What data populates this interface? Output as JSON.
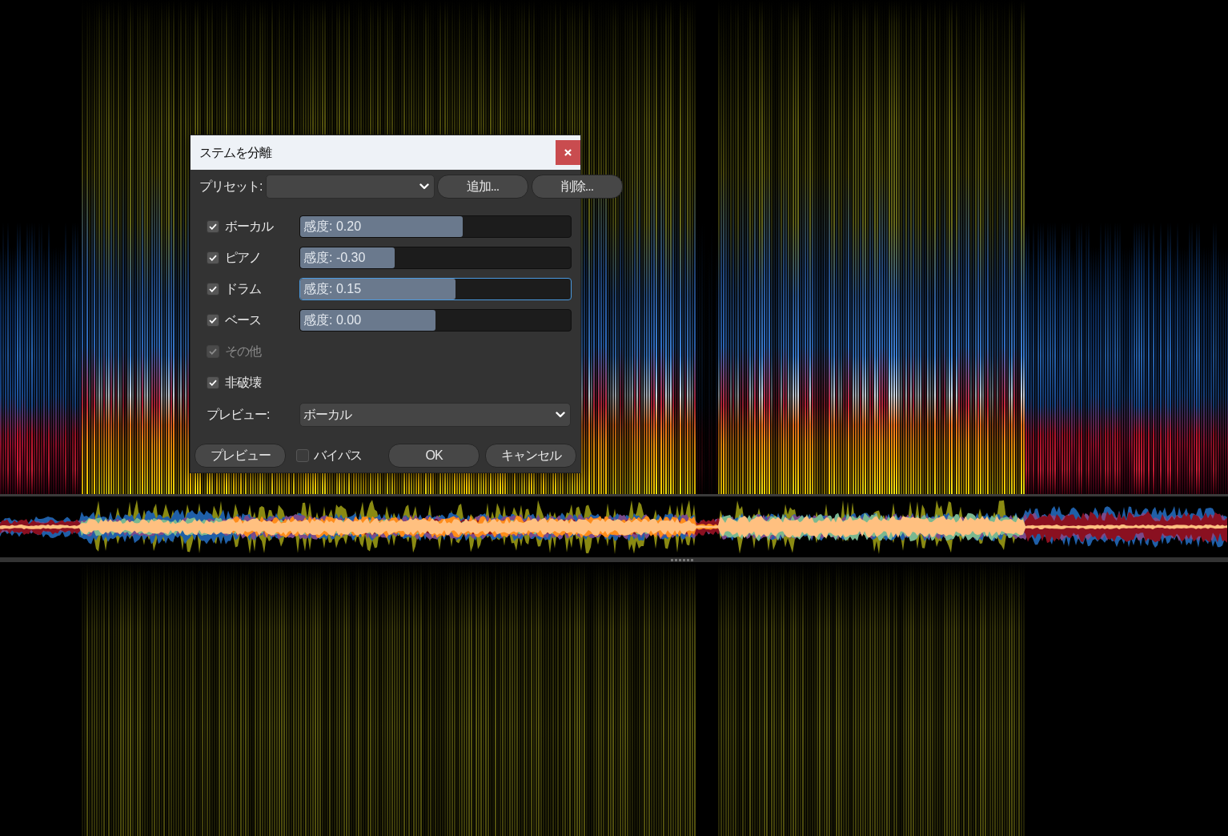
{
  "dialog": {
    "title": "ステムを分離",
    "preset": {
      "label": "プリセット:"
    },
    "preset_buttons": [
      "追加...",
      "削除..."
    ],
    "stems": [
      {
        "kind": "slider",
        "label": "ボーカル",
        "checked": true,
        "disabled": false,
        "slider": {
          "reading": "感度: 0.20",
          "level": 0.6,
          "focused": false
        }
      },
      {
        "kind": "slider",
        "label": "ピアノ",
        "checked": true,
        "disabled": false,
        "slider": {
          "reading": "感度: -0.30",
          "level": 0.35,
          "focused": false
        }
      },
      {
        "kind": "slider",
        "label": "ドラム",
        "checked": true,
        "disabled": false,
        "slider": {
          "reading": "感度: 0.15",
          "level": 0.575,
          "focused": true
        }
      },
      {
        "kind": "slider",
        "label": "ベース",
        "checked": true,
        "disabled": false,
        "slider": {
          "reading": "感度: 0.00",
          "level": 0.5,
          "focused": false
        }
      },
      {
        "kind": "plain",
        "label": "その他",
        "checked": true,
        "disabled": true
      }
    ],
    "non_destructive": {
      "label": "非破壊",
      "checked": true
    },
    "preview_select": {
      "label": "プレビュー:",
      "value": "ボーカル"
    },
    "footer": {
      "preview_button": "プレビュー",
      "bypass": {
        "label": "バイパス",
        "checked": false
      },
      "ok_button": "OK",
      "cancel_button": "キャンセル"
    }
  }
}
